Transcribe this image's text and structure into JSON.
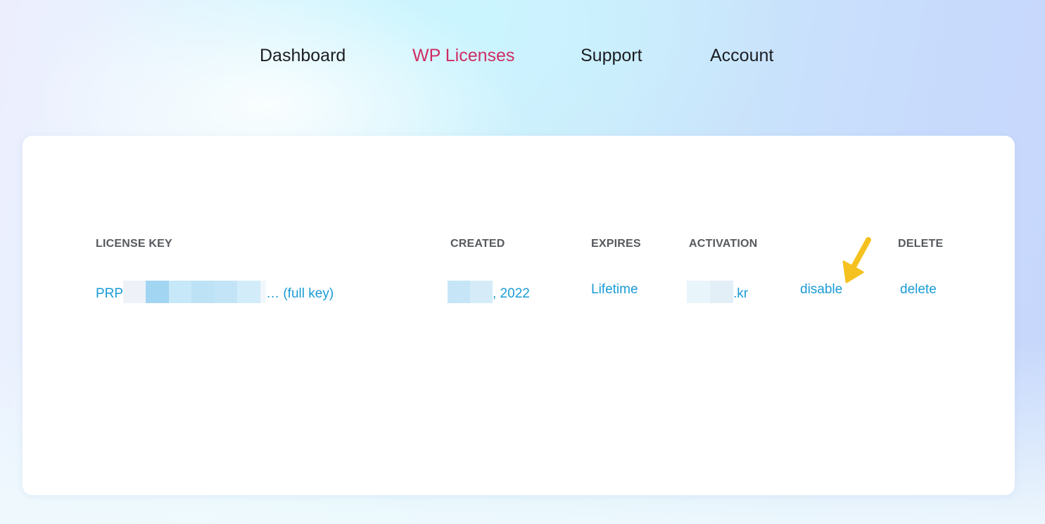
{
  "nav": {
    "dashboard": "Dashboard",
    "licenses": "WP Licenses",
    "support": "Support",
    "account": "Account"
  },
  "table": {
    "headers": {
      "license_key": "LICENSE KEY",
      "created": "CREATED",
      "expires": "EXPIRES",
      "activation": "ACTIVATION",
      "delete": "DELETE"
    },
    "row": {
      "key_prefix": "PRP",
      "key_suffix": "… (full key)",
      "created_suffix": ", 2022",
      "expires": "Lifetime",
      "activation_suffix": ".kr",
      "disable": "disable",
      "delete": "delete"
    }
  },
  "colors": {
    "active_nav": "#d02c63",
    "link": "#1a9bd6",
    "annotation_arrow": "#f5c11e"
  },
  "icons": {
    "annotation": "arrow-pointer-icon"
  }
}
